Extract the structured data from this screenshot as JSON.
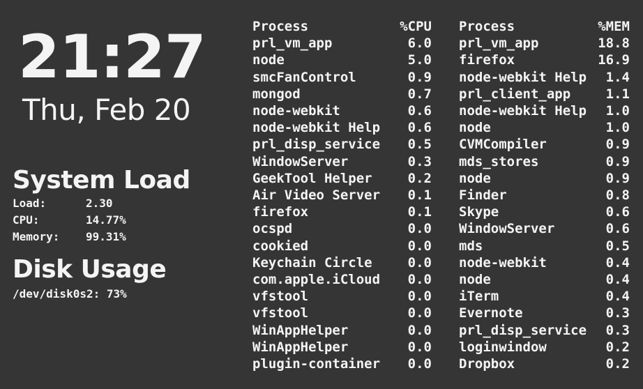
{
  "clock": {
    "time": "21:27",
    "date": "Thu, Feb 20"
  },
  "system_load": {
    "title": "System Load",
    "stats": [
      {
        "label": "Load:",
        "value": "2.30"
      },
      {
        "label": "CPU:",
        "value": "14.77%"
      },
      {
        "label": "Memory:",
        "value": "99.31%"
      }
    ]
  },
  "disk_usage": {
    "title": "Disk Usage",
    "line": "/dev/disk0s2: 73%"
  },
  "cpu_table": {
    "headers": {
      "name": "Process",
      "value": "%CPU"
    },
    "rows": [
      {
        "name": "prl_vm_app",
        "value": "6.0"
      },
      {
        "name": "node",
        "value": "5.0"
      },
      {
        "name": "smcFanControl",
        "value": "0.9"
      },
      {
        "name": "mongod",
        "value": "0.7"
      },
      {
        "name": "node-webkit",
        "value": "0.6"
      },
      {
        "name": "node-webkit Help",
        "value": "0.6"
      },
      {
        "name": "prl_disp_service",
        "value": "0.5"
      },
      {
        "name": "WindowServer",
        "value": "0.3"
      },
      {
        "name": "GeekTool Helper",
        "value": "0.2"
      },
      {
        "name": "Air Video Server",
        "value": "0.1"
      },
      {
        "name": "firefox",
        "value": "0.1"
      },
      {
        "name": "ocspd",
        "value": "0.0"
      },
      {
        "name": "cookied",
        "value": "0.0"
      },
      {
        "name": "Keychain Circle",
        "value": "0.0"
      },
      {
        "name": "com.apple.iCloud",
        "value": "0.0"
      },
      {
        "name": "vfstool",
        "value": "0.0"
      },
      {
        "name": "vfstool",
        "value": "0.0"
      },
      {
        "name": "WinAppHelper",
        "value": "0.0"
      },
      {
        "name": "WinAppHelper",
        "value": "0.0"
      },
      {
        "name": "plugin-container",
        "value": "0.0"
      }
    ]
  },
  "mem_table": {
    "headers": {
      "name": "Process",
      "value": "%MEM"
    },
    "rows": [
      {
        "name": "prl_vm_app",
        "value": "18.8"
      },
      {
        "name": "firefox",
        "value": "16.9"
      },
      {
        "name": "node-webkit Help",
        "value": "1.4"
      },
      {
        "name": "prl_client_app",
        "value": "1.1"
      },
      {
        "name": "node-webkit Help",
        "value": "1.0"
      },
      {
        "name": "node",
        "value": "1.0"
      },
      {
        "name": "CVMCompiler",
        "value": "0.9"
      },
      {
        "name": "mds_stores",
        "value": "0.9"
      },
      {
        "name": "node",
        "value": "0.9"
      },
      {
        "name": "Finder",
        "value": "0.8"
      },
      {
        "name": "Skype",
        "value": "0.6"
      },
      {
        "name": "WindowServer",
        "value": "0.6"
      },
      {
        "name": "mds",
        "value": "0.5"
      },
      {
        "name": "node-webkit",
        "value": "0.4"
      },
      {
        "name": "node",
        "value": "0.4"
      },
      {
        "name": "iTerm",
        "value": "0.4"
      },
      {
        "name": "Evernote",
        "value": "0.3"
      },
      {
        "name": "prl_disp_service",
        "value": "0.3"
      },
      {
        "name": "loginwindow",
        "value": "0.2"
      },
      {
        "name": "Dropbox",
        "value": "0.2"
      }
    ]
  }
}
